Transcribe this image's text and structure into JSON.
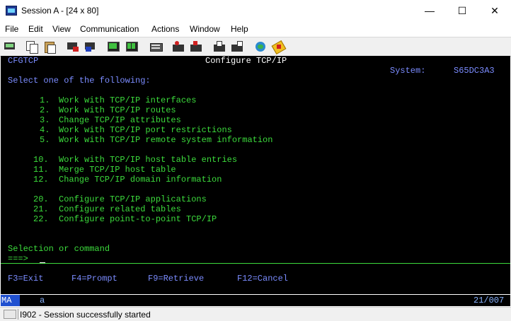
{
  "window": {
    "title": "Session A - [24 x 80]",
    "minimize": "—",
    "maximize": "☐",
    "close": "✕"
  },
  "menu": [
    "File",
    "Edit",
    "View",
    "Communication",
    "Actions",
    "Window",
    "Help"
  ],
  "toolbar_icons": [
    "print-screen-icon",
    "copy-icon",
    "paste-icon",
    "send-icon",
    "receive-icon",
    "display-icon",
    "keypad-icon",
    "macro-icon",
    "record-macro-icon",
    "stop-macro-icon",
    "play-macro-icon",
    "run-macro-icon",
    "support-icon",
    "customize-icon"
  ],
  "terminal": {
    "program": "CFGTCP",
    "screen_title": "Configure TCP/IP",
    "system_label": "System:",
    "system_name": "S65DC3A3",
    "prompt": "Select one of the following:",
    "options": [
      {
        "num": "1.",
        "text": "Work with TCP/IP interfaces"
      },
      {
        "num": "2.",
        "text": "Work with TCP/IP routes"
      },
      {
        "num": "3.",
        "text": "Change TCP/IP attributes"
      },
      {
        "num": "4.",
        "text": "Work with TCP/IP port restrictions"
      },
      {
        "num": "5.",
        "text": "Work with TCP/IP remote system information"
      },
      {
        "num": "10.",
        "text": "Work with TCP/IP host table entries"
      },
      {
        "num": "11.",
        "text": "Merge TCP/IP host table"
      },
      {
        "num": "12.",
        "text": "Change TCP/IP domain information"
      },
      {
        "num": "20.",
        "text": "Configure TCP/IP applications"
      },
      {
        "num": "21.",
        "text": "Configure related tables"
      },
      {
        "num": "22.",
        "text": "Configure point-to-point TCP/IP"
      }
    ],
    "selection_label": "Selection or command",
    "arrow": "===>",
    "fkeys": [
      "F3=Exit",
      "F4=Prompt",
      "F9=Retrieve",
      "F12=Cancel"
    ]
  },
  "oia": {
    "mode": "MA",
    "indicator": "a",
    "cursor_pos": "21/007"
  },
  "status": {
    "text": "I902 - Session successfully started"
  },
  "colors": {
    "terminal_bg": "#000000",
    "green": "#3cdb3c",
    "blue": "#7b8cff",
    "oia_highlight": "#2050d0"
  }
}
